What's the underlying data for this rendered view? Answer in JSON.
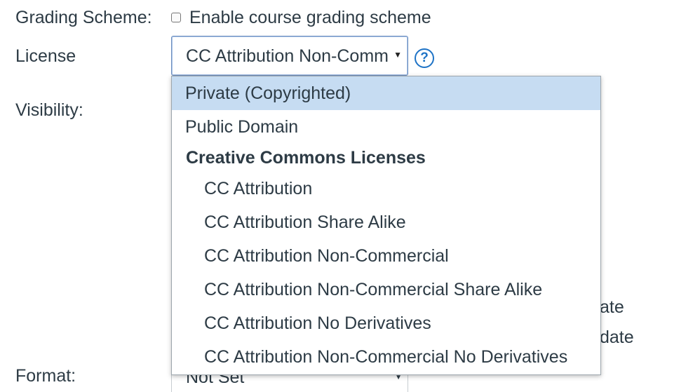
{
  "grading_scheme": {
    "label": "Grading Scheme:",
    "checkbox_label": "Enable course grading scheme",
    "checked": false
  },
  "license": {
    "label": "License",
    "selected_value": "CC Attribution Non-Commercial",
    "help_glyph": "?",
    "dropdown": {
      "options": [
        {
          "label": "Private (Copyrighted)",
          "highlighted": true
        },
        {
          "label": "Public Domain"
        }
      ],
      "group": {
        "label": "Creative Commons Licenses",
        "options": [
          {
            "label": "CC Attribution"
          },
          {
            "label": "CC Attribution Share Alike"
          },
          {
            "label": "CC Attribution Non-Commercial"
          },
          {
            "label": "CC Attribution Non-Commercial Share Alike"
          },
          {
            "label": "CC Attribution No Derivatives"
          },
          {
            "label": "CC Attribution Non-Commercial No Derivatives"
          }
        ]
      }
    }
  },
  "visibility": {
    "label": "Visibility:",
    "partial_text_1": "ate",
    "partial_text_2": "date"
  },
  "format": {
    "label": "Format:",
    "selected_value": "Not Set"
  },
  "colors": {
    "highlight": "#c6dcf2",
    "help_icon": "#1e73c6",
    "text": "#2d3b45"
  }
}
